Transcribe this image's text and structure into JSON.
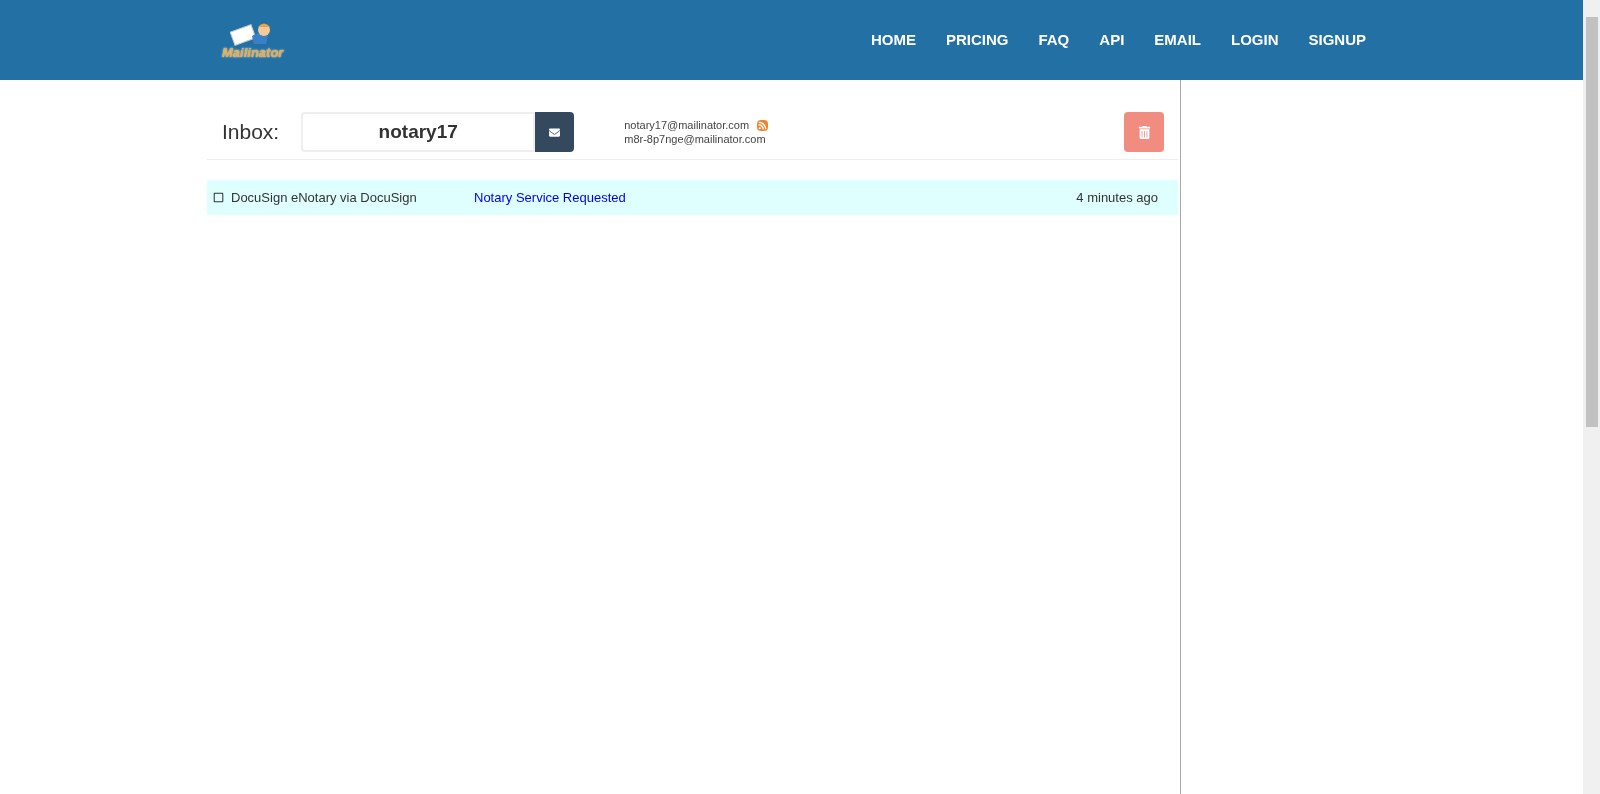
{
  "header": {
    "logo_text": "Mailinator",
    "nav": [
      {
        "label": "HOME"
      },
      {
        "label": "PRICING"
      },
      {
        "label": "FAQ"
      },
      {
        "label": "API"
      },
      {
        "label": "EMAIL"
      },
      {
        "label": "LOGIN"
      },
      {
        "label": "SIGNUP"
      }
    ]
  },
  "inbox": {
    "label": "Inbox:",
    "value": "notary17",
    "addresses": [
      "notary17@mailinator.com",
      "m8r-8p7nge@mailinator.com"
    ]
  },
  "messages": [
    {
      "checked": false,
      "from": "DocuSign eNotary via DocuSign",
      "subject": "Notary Service Requested",
      "time": "4 minutes ago"
    }
  ]
}
